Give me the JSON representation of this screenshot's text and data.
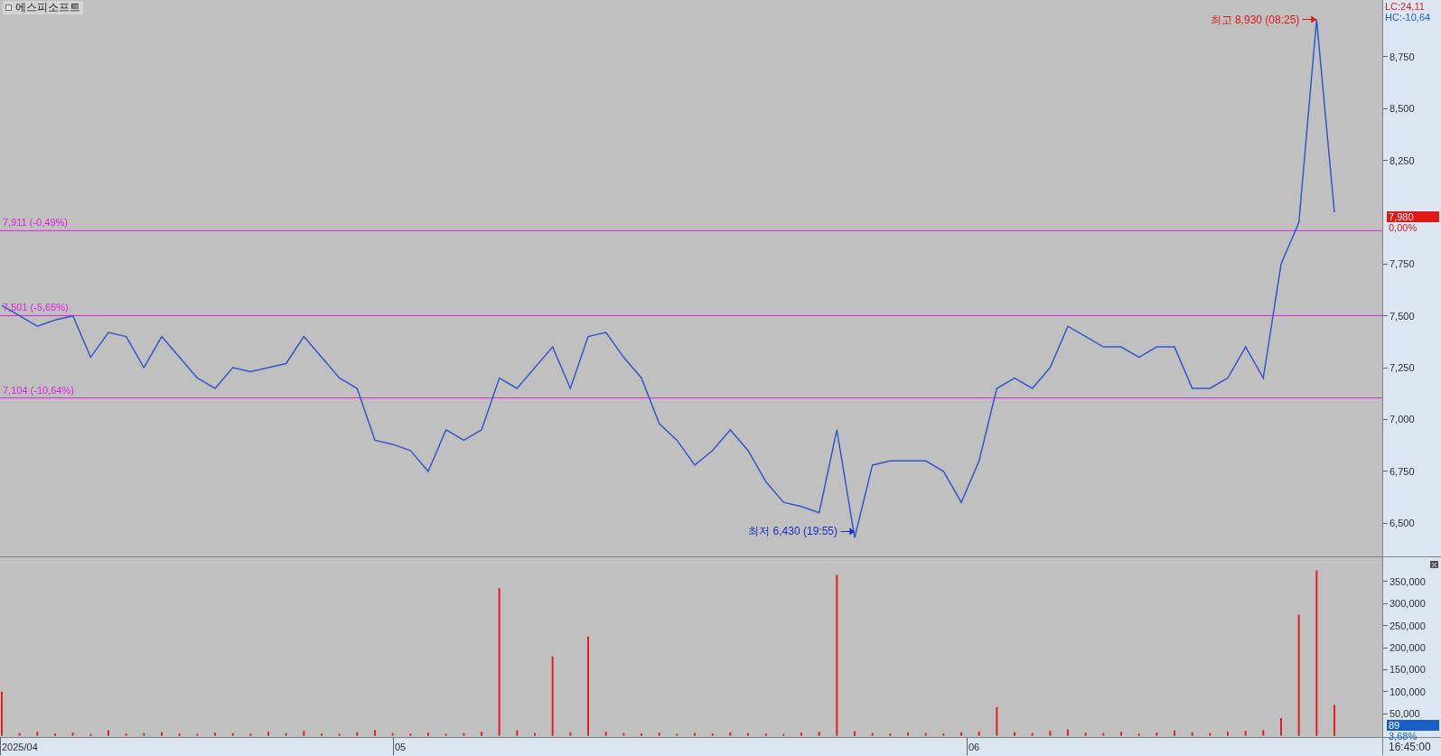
{
  "title": "에스피소프트",
  "price_panel": {
    "indicators": [
      {
        "text": "LC:24,11",
        "color": "#e02020"
      },
      {
        "text": "HC:-10,64",
        "color": "#2060d0"
      }
    ],
    "current_price": {
      "value": "7,980",
      "change": "0,00%"
    },
    "chart_data": {
      "type": "line",
      "ylim": [
        6335,
        9024
      ],
      "yticks": [
        {
          "value": 6500,
          "label": "6,500"
        },
        {
          "value": 6750,
          "label": "6,750"
        },
        {
          "value": 7000,
          "label": "7,000"
        },
        {
          "value": 7250,
          "label": "7,250"
        },
        {
          "value": 7500,
          "label": "7,500"
        },
        {
          "value": 7750,
          "label": "7,750"
        },
        {
          "value": 8250,
          "label": "8,250"
        },
        {
          "value": 8500,
          "label": "8,500"
        },
        {
          "value": 8750,
          "label": "8,750"
        }
      ],
      "series": [
        {
          "color": "#3558c8",
          "values": [
            7550,
            7500,
            7450,
            7480,
            7500,
            7300,
            7420,
            7400,
            7250,
            7400,
            7300,
            7200,
            7150,
            7250,
            7230,
            7250,
            7270,
            7400,
            7300,
            7200,
            7150,
            6900,
            6880,
            6850,
            6750,
            6950,
            6900,
            6950,
            7200,
            7150,
            7250,
            7350,
            7150,
            7400,
            7420,
            7300,
            7200,
            6980,
            6900,
            6780,
            6850,
            6950,
            6850,
            6700,
            6600,
            6580,
            6550,
            6950,
            6430,
            6780,
            6800,
            6800,
            6800,
            6750,
            6600,
            6800,
            7150,
            7200,
            7150,
            7250,
            7450,
            7400,
            7350,
            7350,
            7300,
            7350,
            7350,
            7150,
            7150,
            7200,
            7350,
            7200,
            7750,
            7950,
            8930,
            8000
          ]
        }
      ],
      "ref_lines": [
        {
          "axis": "y",
          "value": 7911,
          "label": "7,911 (-0,49%)",
          "color": "#e020e0"
        },
        {
          "axis": "y",
          "value": 7501,
          "label": "7,501 (-5,65%)",
          "color": "#e020e0"
        },
        {
          "axis": "y",
          "value": 7104,
          "label": "7,104 (-10,64%)",
          "color": "#e020e0"
        }
      ],
      "annotations": [
        "최고 8,930 (08:25)",
        "최저 6,430 (19:55)"
      ]
    }
  },
  "volume_panel": {
    "current_volume": {
      "value": "89",
      "change": "3,68%"
    },
    "chart_data": {
      "type": "bar",
      "ylim": [
        -5000,
        405000
      ],
      "yticks": [
        {
          "value": 50000,
          "label": "50,000"
        },
        {
          "value": 100000,
          "label": "100,000"
        },
        {
          "value": 150000,
          "label": "150,000"
        },
        {
          "value": 200000,
          "label": "200,000"
        },
        {
          "value": 250000,
          "label": "250,000"
        },
        {
          "value": 300000,
          "label": "300,000"
        },
        {
          "value": 350000,
          "label": "350,000"
        }
      ],
      "series": [
        {
          "color": "#e02020",
          "values": [
            100000,
            6000,
            9000,
            5000,
            7000,
            4000,
            12000,
            5000,
            6000,
            8000,
            5000,
            4000,
            7000,
            6000,
            5000,
            9000,
            6000,
            11000,
            5000,
            4000,
            8000,
            13000,
            6000,
            5000,
            7000,
            4000,
            6000,
            9000,
            335000,
            12000,
            6000,
            180000,
            8000,
            225000,
            9000,
            6000,
            5000,
            7000,
            4000,
            6000,
            5000,
            8000,
            6000,
            5000,
            4000,
            7000,
            9000,
            365000,
            10000,
            6000,
            5000,
            7000,
            6000,
            5000,
            8000,
            9000,
            65000,
            8000,
            6000,
            11000,
            14000,
            7000,
            6000,
            9000,
            5000,
            7000,
            12000,
            8000,
            6000,
            9000,
            11000,
            13000,
            40000,
            275000,
            375000,
            70000
          ]
        }
      ]
    }
  },
  "date_labels": [
    "2025/04",
    "05",
    "06"
  ],
  "time_label": "16:45:00"
}
